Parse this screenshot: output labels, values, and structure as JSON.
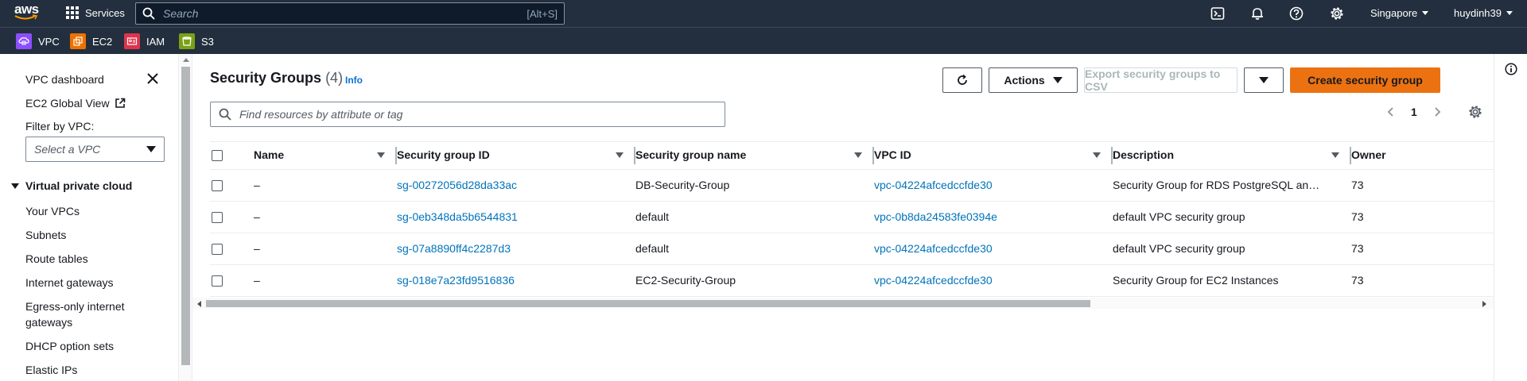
{
  "topnav": {
    "logo_text": "aws",
    "services_label": "Services",
    "search_placeholder": "Search",
    "search_shortcut": "[Alt+S]",
    "region": "Singapore",
    "user": "huydinh39"
  },
  "favorites": [
    {
      "label": "VPC",
      "color": "#8c4fff",
      "icon": "vpc-icon"
    },
    {
      "label": "EC2",
      "color": "#ed7100",
      "icon": "ec2-icon"
    },
    {
      "label": "IAM",
      "color": "#dd344c",
      "icon": "iam-icon"
    },
    {
      "label": "S3",
      "color": "#7aa116",
      "icon": "s3-icon"
    }
  ],
  "sidebar": {
    "dashboard": "VPC dashboard",
    "global_view": "EC2 Global View",
    "filter_label": "Filter by VPC:",
    "filter_placeholder": "Select a VPC",
    "section": "Virtual private cloud",
    "items": [
      "Your VPCs",
      "Subnets",
      "Route tables",
      "Internet gateways",
      "Egress-only internet gateways",
      "DHCP option sets",
      "Elastic IPs"
    ]
  },
  "main": {
    "title": "Security Groups",
    "count": "(4)",
    "info": "Info",
    "actions_label": "Actions",
    "export_label": "Export security groups to CSV",
    "create_label": "Create security group",
    "filter_placeholder": "Find resources by attribute or tag",
    "page": "1"
  },
  "table": {
    "columns": [
      "Name",
      "Security group ID",
      "Security group name",
      "VPC ID",
      "Description",
      "Owner"
    ],
    "rows": [
      {
        "name": "–",
        "sg_id": "sg-00272056d28da33ac",
        "sg_name": "DB-Security-Group",
        "vpc_id": "vpc-04224afcedccfde30",
        "description": "Security Group for RDS PostgreSQL an…",
        "owner": "73"
      },
      {
        "name": "–",
        "sg_id": "sg-0eb348da5b6544831",
        "sg_name": "default",
        "vpc_id": "vpc-0b8da24583fe0394e",
        "description": "default VPC security group",
        "owner": "73"
      },
      {
        "name": "–",
        "sg_id": "sg-07a8890ff4c2287d3",
        "sg_name": "default",
        "vpc_id": "vpc-04224afcedccfde30",
        "description": "default VPC security group",
        "owner": "73"
      },
      {
        "name": "–",
        "sg_id": "sg-018e7a23fd9516836",
        "sg_name": "EC2-Security-Group",
        "vpc_id": "vpc-04224afcedccfde30",
        "description": "Security Group for EC2 Instances",
        "owner": "73"
      }
    ]
  },
  "colors": {
    "nav_bg": "#232f3e",
    "primary_button": "#ec7211",
    "link": "#0073bb"
  }
}
